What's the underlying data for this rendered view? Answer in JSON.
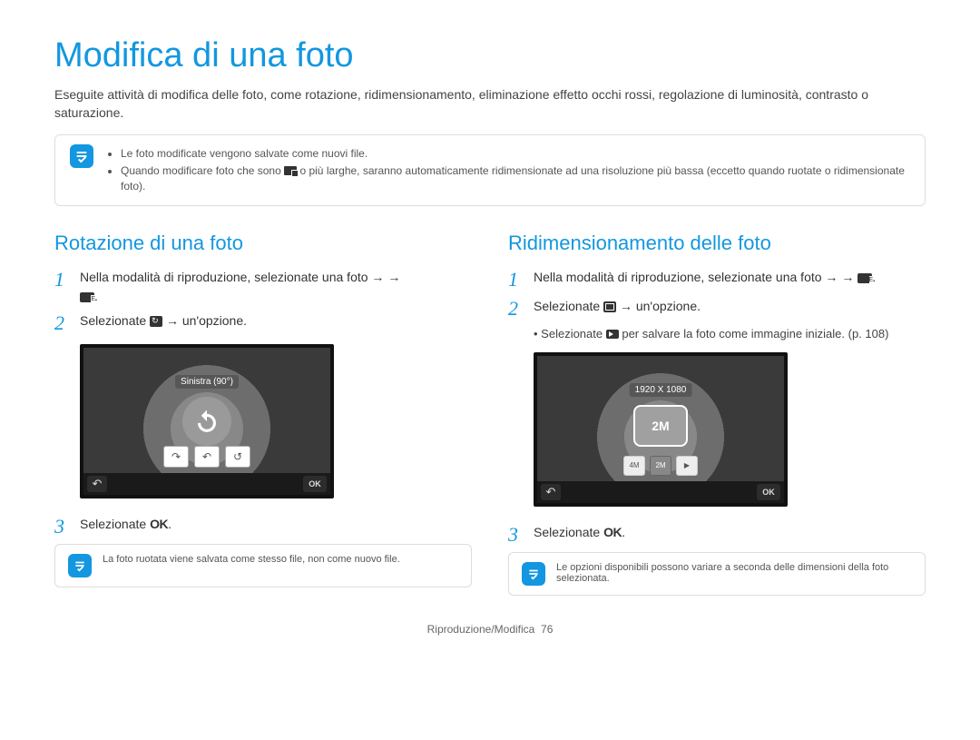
{
  "title": "Modifica di una foto",
  "intro": "Eseguite attività di modifica delle foto, come rotazione, ridimensionamento, eliminazione effetto occhi rossi, regolazione di luminosità, contrasto o saturazione.",
  "top_note": {
    "bullet1": "Le foto modificate vengono salvate come nuovi file.",
    "bullet2_a": "Quando modificare foto che sono ",
    "bullet2_b": " o più larghe, saranno automaticamente ridimensionate ad una risoluzione più bassa (eccetto quando ruotate o ridimensionate foto)."
  },
  "left": {
    "heading": "Rotazione di una foto",
    "step1": "Nella modalità di riproduzione, selezionate una foto → ",
    "step2_a": "Selezionate ",
    "step2_b": " → un'opzione.",
    "screen_title": "Sinistra (90°)",
    "step3_a": "Selezionate ",
    "step3_ok": "OK",
    "note": "La foto ruotata viene salvata come stesso file, non come nuovo file."
  },
  "right": {
    "heading": "Ridimensionamento delle foto",
    "step1": "Nella modalità di riproduzione, selezionate una foto → ",
    "step2_a": "Selezionate ",
    "step2_b": " → un'opzione.",
    "sub_a": "Selezionate ",
    "sub_b": " per salvare la foto come immagine iniziale. (p. 108)",
    "screen_title": "1920 X 1080",
    "opt1": "4M",
    "opt2": "2M",
    "step3_a": "Selezionate ",
    "step3_ok": "OK",
    "note": "Le opzioni disponibili possono variare a seconda delle dimensioni della foto selezionata."
  },
  "footer_a": "Riproduzione/Modifica",
  "footer_b": "76",
  "nums": {
    "n1": "1",
    "n2": "2",
    "n3": "3"
  },
  "ok_btn": "OK"
}
